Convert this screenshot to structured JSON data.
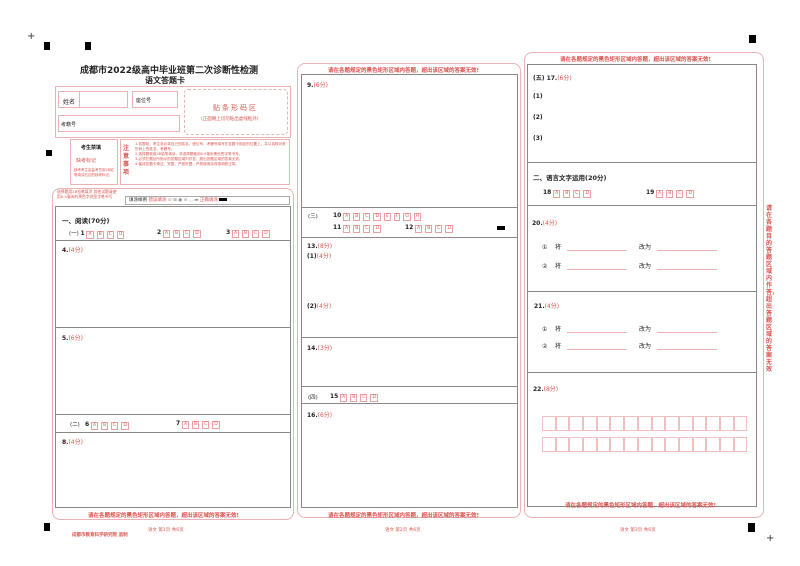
{
  "title": "成都市2022级高中毕业班第二次诊断性检测",
  "subtitle": "语文答题卡",
  "info": {
    "name_label": "姓名",
    "seat_label": "座位号",
    "exam_no_label": "考籍号",
    "barcode_title": "贴条形码区",
    "barcode_note": "(正面朝上切勿贴出虚线框外)"
  },
  "candidate": {
    "title": "考生禁填",
    "missing_label": "缺考标记",
    "note": "缺考考生由监考员用2B铅笔填涂右边的缺考标记。"
  },
  "notice": {
    "title": "注意事项",
    "items": [
      "1.答题前，考生务必将自己的姓名、座位号、考籍号填写在答题卡规定的位置上，并认真核对条形码上的姓名、考籍号。",
      "2.选择题使用2B铅笔填涂，非选择题使用0.5毫米黑色签字笔书写。",
      "3.必须在题目所指示的答题区域内作答，超出答题区域的答案无效。",
      "4.保持答题卡清洁、完整，严禁折叠、严禁使用涂改液和修正带。"
    ]
  },
  "fill": {
    "left_note": "选择题用2B铅笔填涂 其他试题请使用0.5毫米的黑色字迹签字笔书写",
    "sample_label": "填涂样例",
    "wrong_label": "错误填涂",
    "right_label": "正确填涂"
  },
  "warning": "请在各题规定的黑色矩形区域内答题，超出该区域的答案无效!",
  "side_warning": "请在各题目的答题区域内作答，超出答题区域的答案无效",
  "options4": [
    "A",
    "B",
    "C",
    "D"
  ],
  "options8": [
    "A",
    "B",
    "C",
    "D",
    "E",
    "F",
    "G",
    "H"
  ],
  "page1": {
    "section1": "一、阅读(70分)",
    "part1": "(一)",
    "q1": "1",
    "q2": "2",
    "q3": "3",
    "q4": "4.",
    "q4s": "(4分)",
    "q5": "5.",
    "q5s": "(6分)",
    "part2": "(二)",
    "q6": "6",
    "q7": "7",
    "q8": "8.",
    "q8s": "(4分)"
  },
  "page2": {
    "q9": "9.",
    "q9s": "(6分)",
    "part3": "(三)",
    "q10": "10",
    "q11": "11",
    "q12": "12",
    "q13": "13.",
    "q13s": "(8分)",
    "q13a": "(1)",
    "q13as": "(4分)",
    "q13b": "(2)",
    "q13bs": "(4分)",
    "q14": "14.",
    "q14s": "(3分)",
    "part4": "(四)",
    "q15": "15",
    "q16": "16.",
    "q16s": "(6分)"
  },
  "page3": {
    "q17": "(五) 17.",
    "q17s": "(6分)",
    "s1": "(1)",
    "s2": "(2)",
    "s3": "(3)",
    "section2": "二、语言文字运用(20分)",
    "q18": "18",
    "q19": "19",
    "q20": "20.",
    "q20s": "(4分)",
    "q21": "21.",
    "q21s": "(4分)",
    "c1": "①",
    "c2": "②",
    "jiang": "将",
    "gaiwei": "改为",
    "q22": "22.",
    "q22s": "(8分)"
  },
  "footer": {
    "publisher": "成都市教育科学研究院 监制",
    "p1": "语文   第1页   共6页",
    "p2": "语文   第2页   共6页",
    "p3": "语文   第3页   共6页"
  }
}
